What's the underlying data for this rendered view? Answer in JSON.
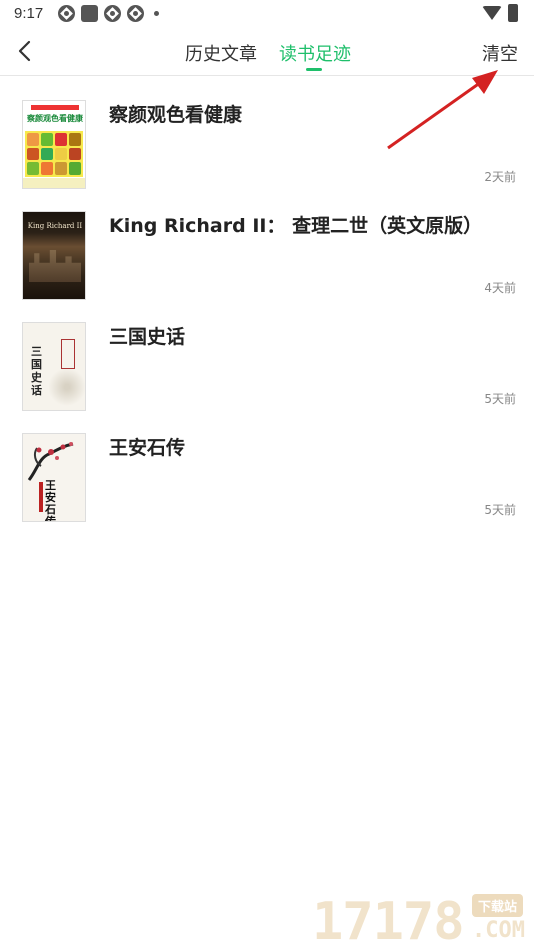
{
  "status_bar": {
    "time": "9:17"
  },
  "header": {
    "tabs": [
      {
        "label": "历史文章",
        "active": false
      },
      {
        "label": "读书足迹",
        "active": true
      }
    ],
    "clear_label": "清空",
    "accent_color": "#1fbf6b"
  },
  "books": [
    {
      "title": "察颜观色看健康",
      "time": "2天前",
      "cover_text": "察颜观色看健康"
    },
    {
      "title": "King Richard II： 查理二世（英文原版）",
      "time": "4天前",
      "cover_text": "King Richard II"
    },
    {
      "title": "三国史话",
      "time": "5天前",
      "cover_text": "三国史话"
    },
    {
      "title": "王安石传",
      "time": "5天前",
      "cover_text": "王安石传"
    }
  ],
  "watermark": {
    "digits": "17178",
    "badge": "下载站",
    "suffix": ".COM"
  },
  "icons": {
    "back": "chevron-left-icon",
    "wifi": "wifi-icon",
    "battery": "battery-icon"
  }
}
